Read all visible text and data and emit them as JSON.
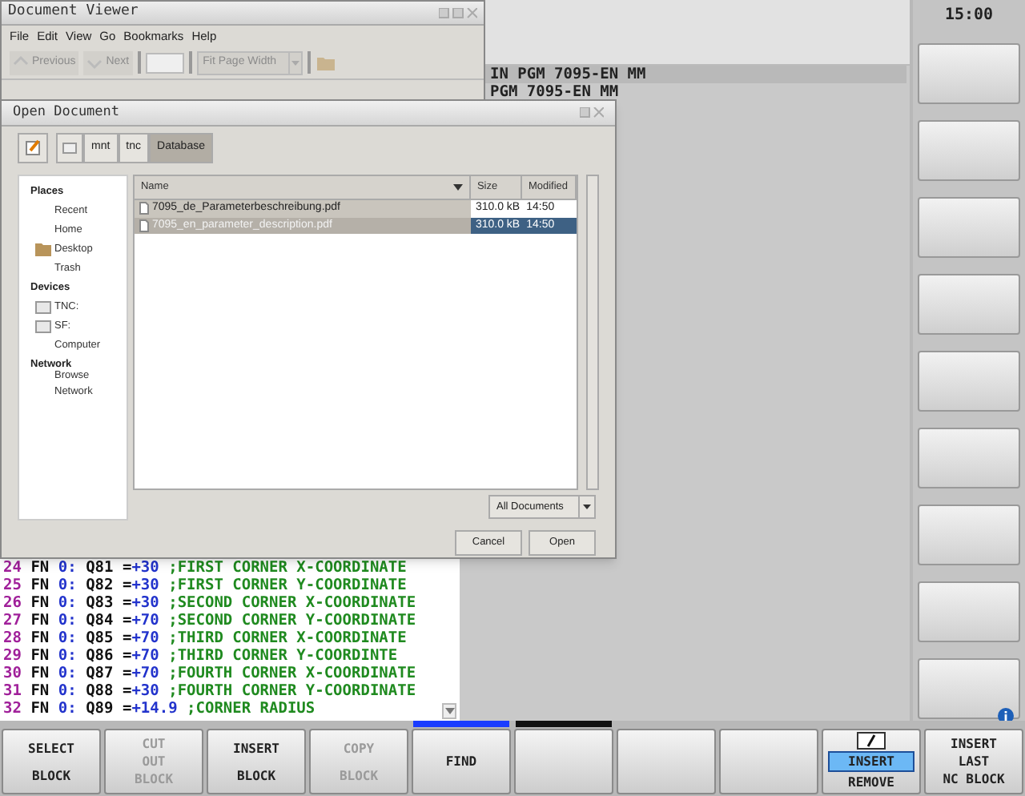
{
  "clock": "15:00",
  "program_header": [
    {
      "text": "IN PGM 7095-EN MM",
      "selected": true
    },
    {
      "text": "PGM 7095-EN MM",
      "selected": false
    }
  ],
  "program_lines": [
    {
      "number": "24",
      "keyword": "FN",
      "func": "0:",
      "param": "Q81",
      "op": "=",
      "value": "+30",
      "comment": ";FIRST CORNER X-COORDINATE"
    },
    {
      "number": "25",
      "keyword": "FN",
      "func": "0:",
      "param": "Q82",
      "op": "=",
      "value": "+30",
      "comment": ";FIRST CORNER Y-COORDINATE"
    },
    {
      "number": "26",
      "keyword": "FN",
      "func": "0:",
      "param": "Q83",
      "op": "=",
      "value": "+30",
      "comment": ";SECOND CORNER X-COORDINATE"
    },
    {
      "number": "27",
      "keyword": "FN",
      "func": "0:",
      "param": "Q84",
      "op": "=",
      "value": "+70",
      "comment": ";SECOND CORNER Y-COORDINATE"
    },
    {
      "number": "28",
      "keyword": "FN",
      "func": "0:",
      "param": "Q85",
      "op": "=",
      "value": "+70",
      "comment": ";THIRD CORNER X-COORDINATE"
    },
    {
      "number": "29",
      "keyword": "FN",
      "func": "0:",
      "param": "Q86",
      "op": "=",
      "value": "+70",
      "comment": ";THIRD CORNER Y-COORDINTE"
    },
    {
      "number": "30",
      "keyword": "FN",
      "func": "0:",
      "param": "Q87",
      "op": "=",
      "value": "+70",
      "comment": ";FOURTH CORNER X-COORDINATE"
    },
    {
      "number": "31",
      "keyword": "FN",
      "func": "0:",
      "param": "Q88",
      "op": "=",
      "value": "+30",
      "comment": ";FOURTH CORNER Y-COORDINATE"
    },
    {
      "number": "32",
      "keyword": "FN",
      "func": "0:",
      "param": "Q89",
      "op": "=",
      "value": "+14.9",
      "comment": ";CORNER RADIUS"
    }
  ],
  "softkeys": [
    {
      "kind": "text",
      "lines": [
        "SELECT",
        "BLOCK"
      ],
      "disabled": false
    },
    {
      "kind": "text",
      "lines": [
        "CUT",
        "OUT",
        "BLOCK"
      ],
      "disabled": true
    },
    {
      "kind": "text",
      "lines": [
        "INSERT",
        "BLOCK"
      ],
      "disabled": false
    },
    {
      "kind": "text",
      "lines": [
        "COPY",
        "BLOCK"
      ],
      "disabled": true
    },
    {
      "kind": "text",
      "lines": [
        "FIND"
      ],
      "disabled": false,
      "color": "#1a3cff"
    },
    {
      "kind": "empty",
      "color": "#111111"
    },
    {
      "kind": "empty"
    },
    {
      "kind": "empty"
    },
    {
      "kind": "toggle",
      "options": [
        {
          "label": "INSERT",
          "selected": true
        },
        {
          "label": "REMOVE",
          "selected": false
        }
      ]
    },
    {
      "kind": "text",
      "lines": [
        "INSERT",
        "LAST",
        "NC BLOCK"
      ],
      "disabled": false
    }
  ],
  "document_viewer": {
    "title": "Document Viewer",
    "menu": [
      "File",
      "Edit",
      "View",
      "Go",
      "Bookmarks",
      "Help"
    ],
    "toolbar": {
      "previous": {
        "label": "Previous",
        "disabled": true
      },
      "next": {
        "label": "Next",
        "disabled": true
      },
      "zoom": {
        "label": "Fit Page Width",
        "disabled": true
      }
    }
  },
  "open_dialog": {
    "title": "Open Document",
    "path": [
      {
        "label": "mnt",
        "selected": false
      },
      {
        "label": "tnc",
        "selected": false
      },
      {
        "label": "Database",
        "selected": true
      }
    ],
    "sidebar": [
      {
        "heading": "Places",
        "items": [
          {
            "label": "Recent",
            "kind": "plain"
          },
          {
            "label": "Home",
            "kind": "plain"
          },
          {
            "label": "Desktop",
            "kind": "folder"
          },
          {
            "label": "Trash",
            "kind": "plain"
          }
        ]
      },
      {
        "heading": "Devices",
        "items": [
          {
            "label": "TNC:",
            "kind": "drive"
          },
          {
            "label": "SF:",
            "kind": "drive"
          },
          {
            "label": "Computer",
            "kind": "plain"
          }
        ]
      },
      {
        "heading": "Network",
        "items": [
          {
            "label": "Browse Network",
            "kind": "plain"
          }
        ]
      }
    ],
    "columns": [
      "Name",
      "Size",
      "Modified"
    ],
    "files": [
      {
        "name": "7095_de_Parameterbeschreibung.pdf",
        "size": "310.0 kB",
        "modified": "14:50",
        "selected": false
      },
      {
        "name": "7095_en_parameter_description.pdf",
        "size": "310.0 kB",
        "modified": "14:50",
        "selected": true
      }
    ],
    "filter": "All Documents",
    "buttons": [
      "Cancel",
      "Open"
    ]
  }
}
